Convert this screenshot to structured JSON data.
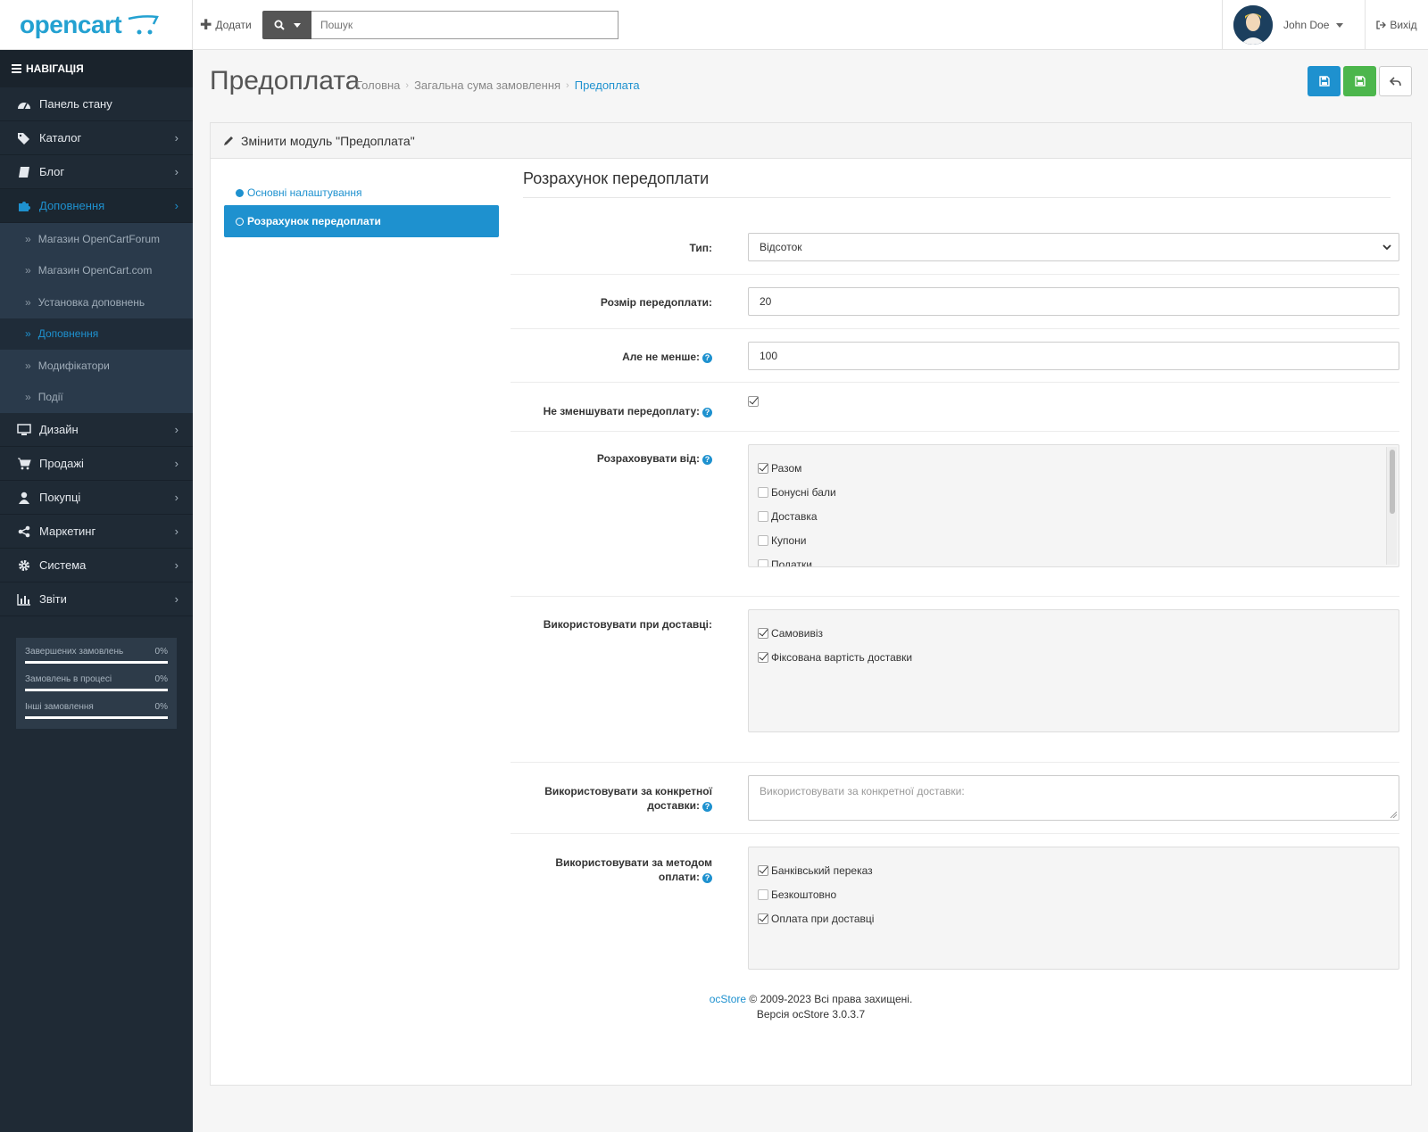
{
  "header": {
    "logo_text": "opencart",
    "add_label": "Додати",
    "search_placeholder": "Пошук",
    "user_name": "John Doe",
    "logout_label": "Вихід"
  },
  "sidebar": {
    "title": "НАВІГАЦІЯ",
    "items": [
      {
        "label": "Панель стану",
        "icon": "dashboard-icon"
      },
      {
        "label": "Каталог",
        "icon": "tags-icon"
      },
      {
        "label": "Блог",
        "icon": "book-icon"
      },
      {
        "label": "Доповнення",
        "icon": "puzzle-icon"
      },
      {
        "label": "Дизайн",
        "icon": "monitor-icon"
      },
      {
        "label": "Продажі",
        "icon": "cart-icon"
      },
      {
        "label": "Покупці",
        "icon": "user-icon"
      },
      {
        "label": "Маркетинг",
        "icon": "share-icon"
      },
      {
        "label": "Система",
        "icon": "gear-icon"
      },
      {
        "label": "Звіти",
        "icon": "bar-chart-icon"
      }
    ],
    "submenu": [
      "Магазин OpenCartForum",
      "Магазин OpenCart.com",
      "Установка доповнень",
      "Доповнення",
      "Модифікатори",
      "Події"
    ],
    "stats": [
      {
        "label": "Завершених замовлень",
        "value": "0%"
      },
      {
        "label": "Замовлень в процесі",
        "value": "0%"
      },
      {
        "label": "Інші замовлення",
        "value": "0%"
      }
    ]
  },
  "page": {
    "title": "Предоплата",
    "breadcrumb": [
      "Головна",
      "Загальна сума замовлення",
      "Предоплата"
    ]
  },
  "panel": {
    "heading": "Змінити модуль \"Предоплата\"",
    "tabs": [
      "Основні налаштування",
      "Розрахунок передоплати"
    ],
    "section_title": "Розрахунок передоплати"
  },
  "form": {
    "type_label": "Тип:",
    "type_value": "Відсоток",
    "size_label": "Розмір передоплати:",
    "size_value": "20",
    "min_label": "Але не менше:",
    "min_value": "100",
    "no_reduce_label": "Не зменшувати передоплату:",
    "calc_from_label": "Розраховувати від:",
    "calc_from_options": [
      {
        "label": "Разом",
        "checked": true
      },
      {
        "label": "Бонусні бали",
        "checked": false
      },
      {
        "label": "Доставка",
        "checked": false
      },
      {
        "label": "Купони",
        "checked": false
      },
      {
        "label": "Податки",
        "checked": false
      }
    ],
    "shipping_label": "Використовувати при доставці:",
    "shipping_options": [
      {
        "label": "Самовивіз",
        "checked": true
      },
      {
        "label": "Фіксована вартість доставки",
        "checked": true
      }
    ],
    "specific_shipping_label_1": "Використовувати за конкретної",
    "specific_shipping_label_2": "доставки:",
    "specific_shipping_placeholder": "Використовувати за конкретної доставки:",
    "payment_label_1": "Використовувати за методом",
    "payment_label_2": "оплати:",
    "payment_options": [
      {
        "label": "Банківський переказ",
        "checked": true
      },
      {
        "label": "Безкоштовно",
        "checked": false
      },
      {
        "label": "Оплата при доставці",
        "checked": true
      }
    ]
  },
  "footer": {
    "brand": "ocStore",
    "copyright": "© 2009-2023 Всі права захищені.",
    "version": "Версія ocStore 3.0.3.7"
  },
  "colors": {
    "primary": "#1e91cf",
    "success": "#4cb64c",
    "sidebar_bg": "#1f2a35"
  }
}
